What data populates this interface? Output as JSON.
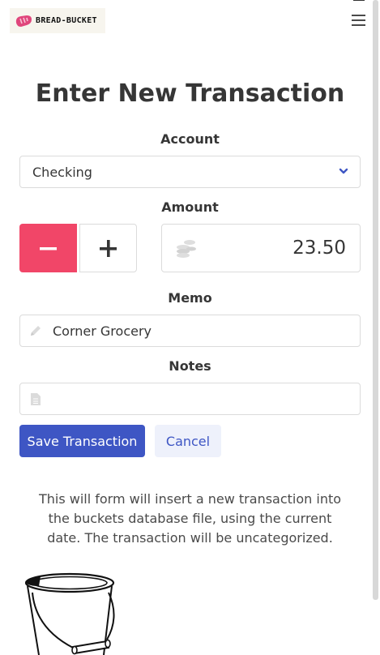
{
  "nav": {
    "brand_text": "BREAD-BUCKET",
    "logo_icon": "bread-icon",
    "menu_icon": "hamburger-icon"
  },
  "form": {
    "title": "Enter New Transaction",
    "account": {
      "label": "Account",
      "selected": "Checking",
      "icon": "chevron-down-icon"
    },
    "amount": {
      "label": "Amount",
      "minus_symbol": "−",
      "plus_symbol": "+",
      "value": "23.50",
      "icon": "coins-icon"
    },
    "memo": {
      "label": "Memo",
      "value": "Corner Grocery",
      "icon": "pencil-icon"
    },
    "notes": {
      "label": "Notes",
      "value": "",
      "icon": "document-icon"
    },
    "save_label": "Save Transaction",
    "cancel_label": "Cancel"
  },
  "info_text": "This will form will insert a new transaction into the buckets database file, using the current date. The transaction will be uncategorized.",
  "illustration": "bucket-drawing",
  "colors": {
    "danger": "#f14668",
    "primary": "#3e56c4",
    "light_primary": "#eef1fb",
    "brand_pink": "#e0467c"
  }
}
